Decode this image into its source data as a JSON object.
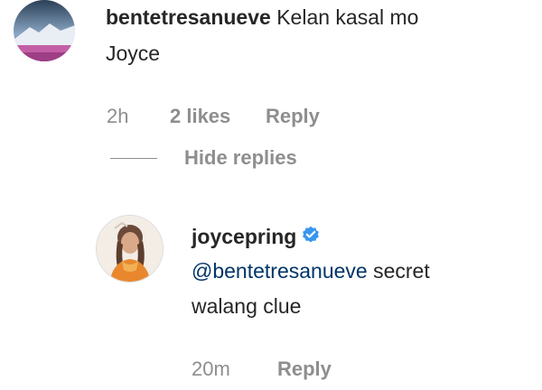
{
  "comment": {
    "username": "bentetresanueve",
    "text_line1": "Kelan kasal mo",
    "text_line2": "Joyce",
    "time": "2h",
    "likes": "2 likes",
    "reply_label": "Reply"
  },
  "hide_replies_label": "Hide replies",
  "reply": {
    "username": "joycepring",
    "verified_icon": "verified-badge-icon",
    "mention": "@bentetresanueve",
    "text_line1_rest": " secret",
    "text_line2": "walang clue",
    "time": "20m",
    "reply_label": "Reply"
  },
  "colors": {
    "text": "#262626",
    "meta": "#8e8e8e",
    "mention": "#003569",
    "verified": "#3897f0"
  }
}
